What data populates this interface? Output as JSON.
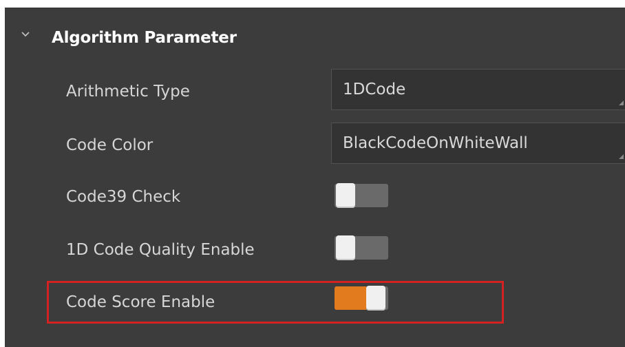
{
  "section": {
    "title": "Algorithm Parameter",
    "expanded": true,
    "icon": "chevron-down-icon"
  },
  "params": {
    "arithmetic_type": {
      "label": "Arithmetic Type",
      "value": "1DCode"
    },
    "code_color": {
      "label": "Code Color",
      "value": "BlackCodeOnWhiteWall"
    },
    "code39_check": {
      "label": "Code39 Check",
      "enabled": false
    },
    "quality_enable": {
      "label": "1D Code Quality Enable",
      "enabled": false
    },
    "score_enable": {
      "label": "Code Score Enable",
      "enabled": true,
      "highlighted": true
    }
  },
  "colors": {
    "panel_bg": "#3c3c3d",
    "toggle_on": "#e27a1e",
    "highlight": "#d42222"
  }
}
